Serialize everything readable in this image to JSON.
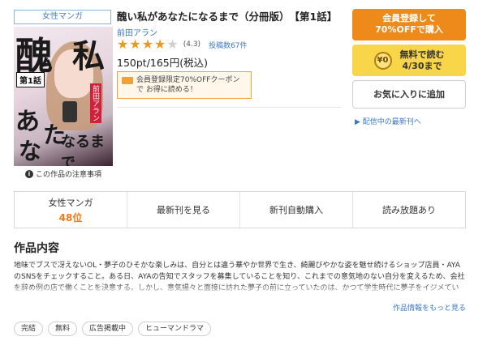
{
  "genre_tag": "女性マンガ",
  "cover": {
    "title_chars": [
      "醜",
      "私",
      "あ",
      "な",
      "た",
      "に",
      "なるまで"
    ],
    "volume_label": "第1話",
    "author_vertical": "前田アラン"
  },
  "caution_link": "この作品の注意事項",
  "book": {
    "title": "醜い私があなたになるまで（分冊版）　【第1話】",
    "author": "前田アラン",
    "rating": 4.3,
    "rating_text": "(4.3)",
    "review_count": "投稿数67件",
    "price": "150pt/165円(税込)",
    "coupon_text": "会員登録限定70%OFFクーポンで お得に読める！"
  },
  "buttons": {
    "register_line1": "会員登録して",
    "register_line2": "70%OFFで購入",
    "sample_coin": "¥0",
    "sample_line1": "無料で読む",
    "sample_line2": "4/30まで",
    "favorite": "お気に入りに追加",
    "latest_link": "配信中の最新刊へ"
  },
  "stats": {
    "genre_label": "女性マンガ",
    "rank": "48位",
    "latest_vol": "最新刊を見る",
    "auto_buy": "新刊自動購入",
    "unlimited": "読み放題あり"
  },
  "description": {
    "heading": "作品内容",
    "text": "地味でブスで冴えないOL・夢子のひそかな楽しみは、自分とは違う華やか世界で生き、綺麗びやかな姿を魅せ続けるショップ店員・AYAのSNSをチェックすること。ある日、AYAの告知でスタッフを募集していることを知り、これまでの意気地のない自分を変えるため、会社を辞め例の店で働くことを決意する。しかし、意気揚々と面接に訪れた夢子の前に立っていたのは、かつて学生時代に夢子をイジメていた張本人であり主犯格の殿だった。『憧れの\"AYA\"が、まさか彼女だったなんて……!?』　恐怖から逃げ腰になる夢子だったが、昔とは打って変わって愛想",
    "more_link": "作品情報をもっと見る"
  },
  "tags": [
    "完結",
    "無料",
    "広告掲載中",
    "ヒューマンドラマ"
  ],
  "colors": {
    "register_button": "#ee8a1a",
    "sample_button": "#f9d54a",
    "link": "#3a77c5",
    "rank": "#ee7a1a"
  }
}
